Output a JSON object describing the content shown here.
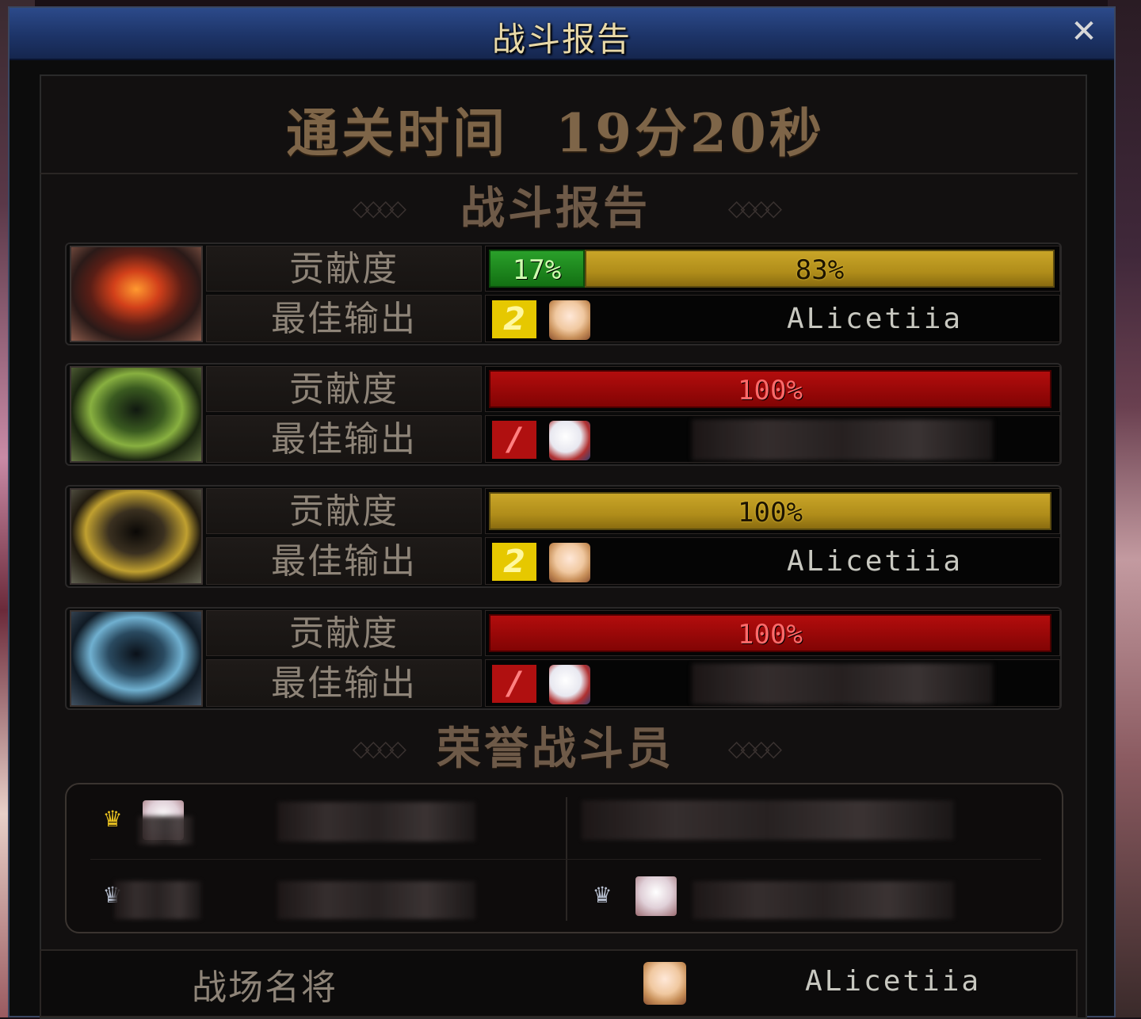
{
  "window": {
    "title": "战斗报告"
  },
  "clear_time": {
    "label": "通关时间",
    "value": "19分20秒"
  },
  "sections": {
    "report": "战斗报告",
    "honor": "荣誉战斗员"
  },
  "rows": [
    {
      "boss_icon": "fire-mask-icon",
      "contrib_label": "贡献度",
      "best_label": "最佳输出",
      "bars": [
        {
          "text": "17%",
          "value": 17,
          "color": "#2aa02a"
        },
        {
          "text": "83%",
          "value": 83,
          "color": "#c9a528"
        }
      ],
      "rank": "2",
      "player": "ALicetiia"
    },
    {
      "boss_icon": "green-mask-icon",
      "contrib_label": "贡献度",
      "best_label": "最佳输出",
      "bars": [
        {
          "text": "100%",
          "value": 100,
          "color": "#b30d0d"
        }
      ],
      "rank": "/",
      "player": ""
    },
    {
      "boss_icon": "gold-mask-icon",
      "contrib_label": "贡献度",
      "best_label": "最佳输出",
      "bars": [
        {
          "text": "100%",
          "value": 100,
          "color": "#c9a528"
        }
      ],
      "rank": "2",
      "player": "ALicetiia"
    },
    {
      "boss_icon": "blue-mask-icon",
      "contrib_label": "贡献度",
      "best_label": "最佳输出",
      "bars": [
        {
          "text": "100%",
          "value": 100,
          "color": "#b30d0d"
        }
      ],
      "rank": "/",
      "player": ""
    }
  ],
  "footer": {
    "label": "战场名将",
    "player": "ALicetiia"
  },
  "icons": {
    "close": "close-icon",
    "crown_gold": "gold-crown-icon",
    "crown_silver": "silver-crown-icon"
  }
}
